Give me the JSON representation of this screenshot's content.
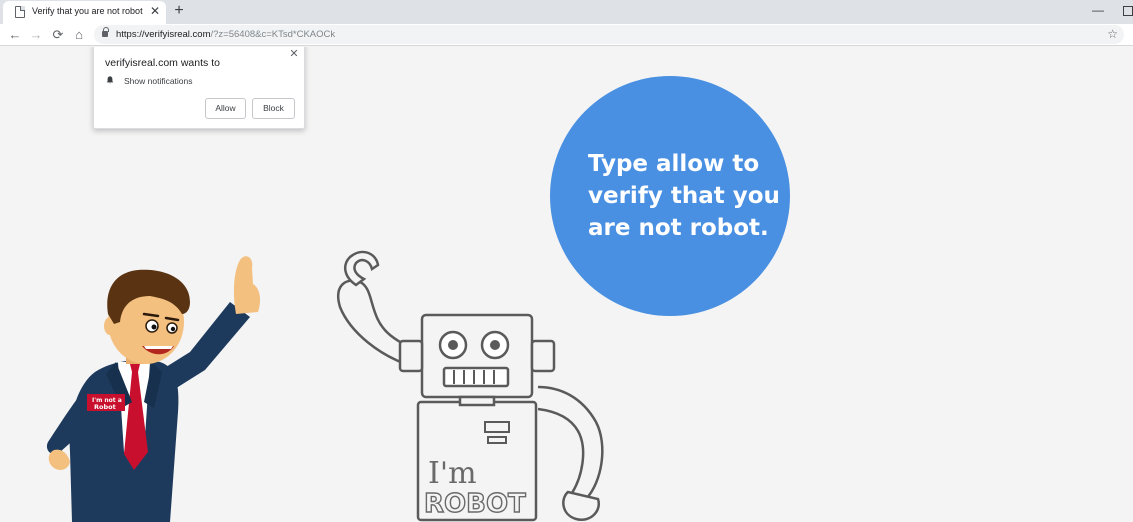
{
  "browser": {
    "tab_title": "Verify that you are not robot",
    "tab_close": "✕",
    "new_tab": "+",
    "window_minimize": "—"
  },
  "toolbar": {
    "back": "←",
    "forward": "→",
    "reload": "⟳",
    "home": "⌂",
    "url_host": "https://verifyisreal.com",
    "url_rest": "/?z=56408&c=KTsd*CKAOCk",
    "bookmark": "☆"
  },
  "prompt": {
    "title": "verifyisreal.com wants to",
    "close": "✕",
    "permission": "Show notifications",
    "allow": "Allow",
    "block": "Block"
  },
  "page": {
    "bubble_lines": [
      "Type allow to",
      "verify that you",
      "are not robot."
    ],
    "bubble_color": "#4a90e2",
    "badge_line1": "I'm not a",
    "badge_line2": "Robot",
    "robot_line1": "I'm",
    "robot_line2": "ROBOT"
  }
}
